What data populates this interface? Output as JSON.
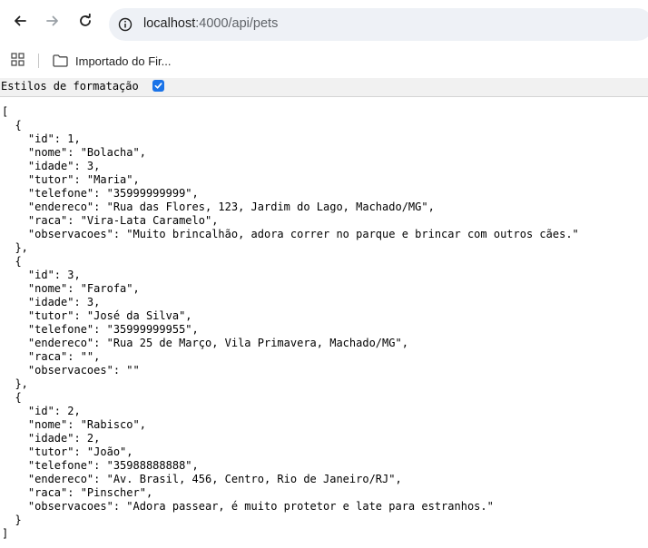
{
  "browser": {
    "url_host": "localhost",
    "url_path": ":4000/api/pets",
    "bookmark_folder": "Importado do Fir..."
  },
  "formatting": {
    "label": "Estilos de formatação",
    "checked": true
  },
  "json_text": "[\n  {\n    \"id\": 1,\n    \"nome\": \"Bolacha\",\n    \"idade\": 3,\n    \"tutor\": \"Maria\",\n    \"telefone\": \"35999999999\",\n    \"endereco\": \"Rua das Flores, 123, Jardim do Lago, Machado/MG\",\n    \"raca\": \"Vira-Lata Caramelo\",\n    \"observacoes\": \"Muito brincalhão, adora correr no parque e brincar com outros cães.\"\n  },\n  {\n    \"id\": 3,\n    \"nome\": \"Farofa\",\n    \"idade\": 3,\n    \"tutor\": \"José da Silva\",\n    \"telefone\": \"35999999955\",\n    \"endereco\": \"Rua 25 de Março, Vila Primavera, Machado/MG\",\n    \"raca\": \"\",\n    \"observacoes\": \"\"\n  },\n  {\n    \"id\": 2,\n    \"nome\": \"Rabisco\",\n    \"idade\": 2,\n    \"tutor\": \"João\",\n    \"telefone\": \"35988888888\",\n    \"endereco\": \"Av. Brasil, 456, Centro, Rio de Janeiro/RJ\",\n    \"raca\": \"Pinscher\",\n    \"observacoes\": \"Adora passear, é muito protetor e late para estranhos.\"\n  }\n]",
  "icons": {
    "back": "back-arrow-icon",
    "forward": "forward-arrow-icon",
    "reload": "reload-icon",
    "site_info": "site-info-icon",
    "apps": "apps-grid-icon",
    "folder": "folder-icon",
    "check": "checkmark-icon"
  },
  "colors": {
    "omnibox_bg": "#eef1f6",
    "checkbox_accent": "#1a73e8",
    "format_bar_bg": "#f1f1f1"
  }
}
